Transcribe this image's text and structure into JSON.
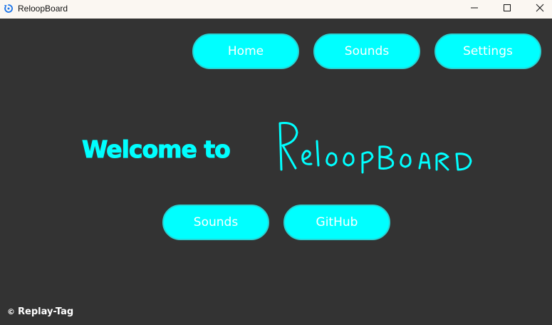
{
  "window": {
    "title": "ReloopBoard"
  },
  "nav": {
    "home_label": "Home",
    "sounds_label": "Sounds",
    "settings_label": "Settings"
  },
  "hero": {
    "welcome_text": "Welcome to",
    "brand_name": "ReloopBoard"
  },
  "actions": {
    "sounds_label": "Sounds",
    "github_label": "GitHub"
  },
  "footer": {
    "copyright_symbol": "©",
    "author": "Replay-Tag"
  },
  "colors": {
    "background": "#333333",
    "accent": "#00ffff",
    "titlebar": "#fbf7f2",
    "button_text": "#ffffff"
  },
  "icons": {
    "app": "reloop-icon",
    "minimize": "minimize-icon",
    "maximize": "maximize-icon",
    "close": "close-icon"
  }
}
